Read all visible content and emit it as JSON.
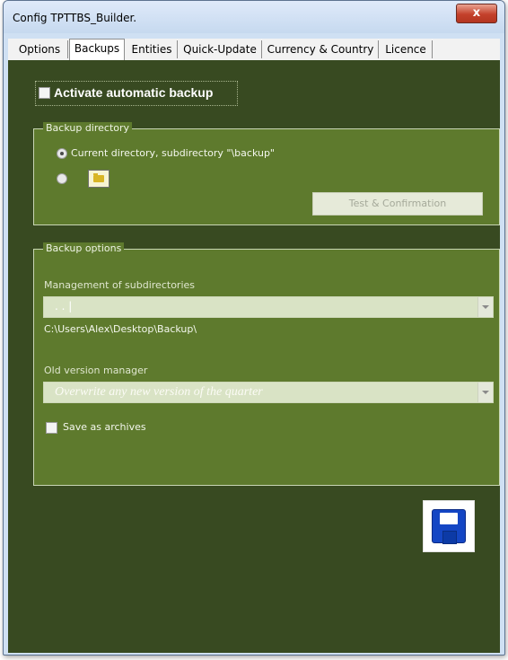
{
  "window": {
    "title": "Config TPTTBS_Builder.",
    "close_label": "x"
  },
  "tabs": [
    {
      "label": "Options",
      "active": false
    },
    {
      "label": "Backups",
      "active": true
    },
    {
      "label": "Entities",
      "active": false
    },
    {
      "label": "Quick-Update",
      "active": false
    },
    {
      "label": "Currency & Country",
      "active": false
    },
    {
      "label": "Licence",
      "active": false
    }
  ],
  "backups": {
    "activate_label": "Activate automatic backup",
    "activate_checked": false,
    "backup_directory": {
      "legend": "Backup directory",
      "option_current_label": "Current directory, subdirectory \"\\backup\"",
      "option_current_selected": true,
      "option_custom_selected": false,
      "folder_icon": "folder-icon",
      "test_button_label": "Test & Confirmation"
    },
    "backup_options": {
      "legend": "Backup options",
      "subdirectories_label": "Management of subdirectories",
      "subdirectories_value": ". . |",
      "path_text": "C:\\Users\\Alex\\Desktop\\Backup\\",
      "old_version_label": "Old version manager",
      "old_version_value": "Overwrite any new version of the quarter",
      "save_archives_label": "Save as archives",
      "save_archives_checked": false
    },
    "save_icon": "floppy-disk-icon"
  },
  "colors": {
    "content_bg": "#384a21",
    "group_bg": "#5e7a2d",
    "accent_blue": "#1446c4"
  }
}
